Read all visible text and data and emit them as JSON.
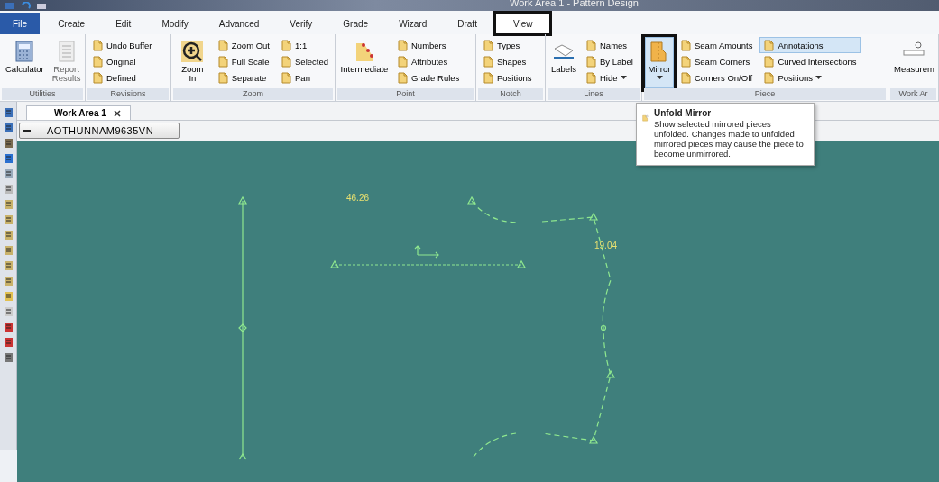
{
  "window": {
    "title": "Work Area 1 - Pattern Design"
  },
  "menu_tabs": [
    {
      "label": "File",
      "selected": true,
      "highlighted": false
    },
    {
      "label": "Create",
      "selected": false,
      "highlighted": false
    },
    {
      "label": "Edit",
      "selected": false,
      "highlighted": false
    },
    {
      "label": "Modify",
      "selected": false,
      "highlighted": false
    },
    {
      "label": "Advanced",
      "selected": false,
      "highlighted": false
    },
    {
      "label": "Verify",
      "selected": false,
      "highlighted": false
    },
    {
      "label": "Grade",
      "selected": false,
      "highlighted": false
    },
    {
      "label": "Wizard",
      "selected": false,
      "highlighted": false
    },
    {
      "label": "Draft",
      "selected": false,
      "highlighted": false
    },
    {
      "label": "View",
      "selected": false,
      "highlighted": true
    }
  ],
  "ribbon": {
    "groups": [
      {
        "label": "Utilities",
        "large": [
          {
            "label": "Calculator",
            "disabled": false,
            "selected": false,
            "highlighted": false,
            "dropdown": false
          },
          {
            "label": "Report Results",
            "disabled": true,
            "selected": false,
            "highlighted": false,
            "dropdown": false
          }
        ]
      },
      {
        "label": "Revisions",
        "small": [
          {
            "label": "Undo Buffer",
            "selected": false,
            "dropdown": false
          },
          {
            "label": "Original",
            "selected": false,
            "dropdown": false
          },
          {
            "label": "Defined",
            "selected": false,
            "dropdown": false
          }
        ]
      },
      {
        "label": "Zoom",
        "large": [
          {
            "label": "Zoom In",
            "disabled": false,
            "selected": false,
            "highlighted": false,
            "dropdown": false
          }
        ],
        "small": [
          {
            "label": "Zoom Out",
            "selected": false,
            "dropdown": false
          },
          {
            "label": "Full Scale",
            "selected": false,
            "dropdown": false
          },
          {
            "label": "Separate",
            "selected": false,
            "dropdown": false
          },
          {
            "label": "1:1",
            "selected": false,
            "dropdown": false
          },
          {
            "label": "Selected",
            "selected": false,
            "dropdown": false
          },
          {
            "label": "Pan",
            "selected": false,
            "dropdown": false
          }
        ]
      },
      {
        "label": "Point",
        "large": [
          {
            "label": "Intermediate",
            "disabled": false,
            "selected": false,
            "highlighted": false,
            "dropdown": false
          }
        ],
        "small": [
          {
            "label": "Numbers",
            "selected": false,
            "dropdown": false
          },
          {
            "label": "Attributes",
            "selected": false,
            "dropdown": false
          },
          {
            "label": "Grade Rules",
            "selected": false,
            "dropdown": false
          }
        ]
      },
      {
        "label": "Notch",
        "small": [
          {
            "label": "Types",
            "selected": false,
            "dropdown": false
          },
          {
            "label": "Shapes",
            "selected": false,
            "dropdown": false
          },
          {
            "label": "Positions",
            "selected": false,
            "dropdown": false
          }
        ]
      },
      {
        "label": "Lines",
        "large": [
          {
            "label": "Labels",
            "disabled": false,
            "selected": false,
            "highlighted": false,
            "dropdown": false
          }
        ],
        "small": [
          {
            "label": "Names",
            "selected": false,
            "dropdown": false
          },
          {
            "label": "By Label",
            "selected": false,
            "dropdown": false
          },
          {
            "label": "Hide",
            "selected": false,
            "dropdown": true
          }
        ]
      },
      {
        "label": "Piece",
        "large": [
          {
            "label": "Mirror",
            "disabled": false,
            "selected": true,
            "highlighted": true,
            "dropdown": true
          }
        ],
        "small": [
          {
            "label": "Seam Amounts",
            "selected": false,
            "dropdown": false
          },
          {
            "label": "Seam Corners",
            "selected": false,
            "dropdown": false
          },
          {
            "label": "Corners On/Off",
            "selected": false,
            "dropdown": false
          },
          {
            "label": "Annotations",
            "selected": true,
            "dropdown": false
          },
          {
            "label": "Curved Intersections",
            "selected": false,
            "dropdown": false
          },
          {
            "label": "Positions",
            "selected": false,
            "dropdown": true
          }
        ]
      },
      {
        "label": "Work Ar",
        "large": [
          {
            "label": "Measurem",
            "disabled": false,
            "selected": false,
            "highlighted": false,
            "dropdown": false
          }
        ]
      }
    ]
  },
  "work_tabs": [
    {
      "label": "Work Area 1",
      "selected": true
    }
  ],
  "piece_selector": {
    "value": "AOTHUNNAM9635VN"
  },
  "tooltip": {
    "title": "Unfold Mirror",
    "text": "Show selected mirrored pieces unfolded.  Changes made to unfolded mirrored pieces may cause the piece to become unmirrored."
  },
  "canvas": {
    "labels": [
      "46.26",
      "19.04"
    ]
  }
}
